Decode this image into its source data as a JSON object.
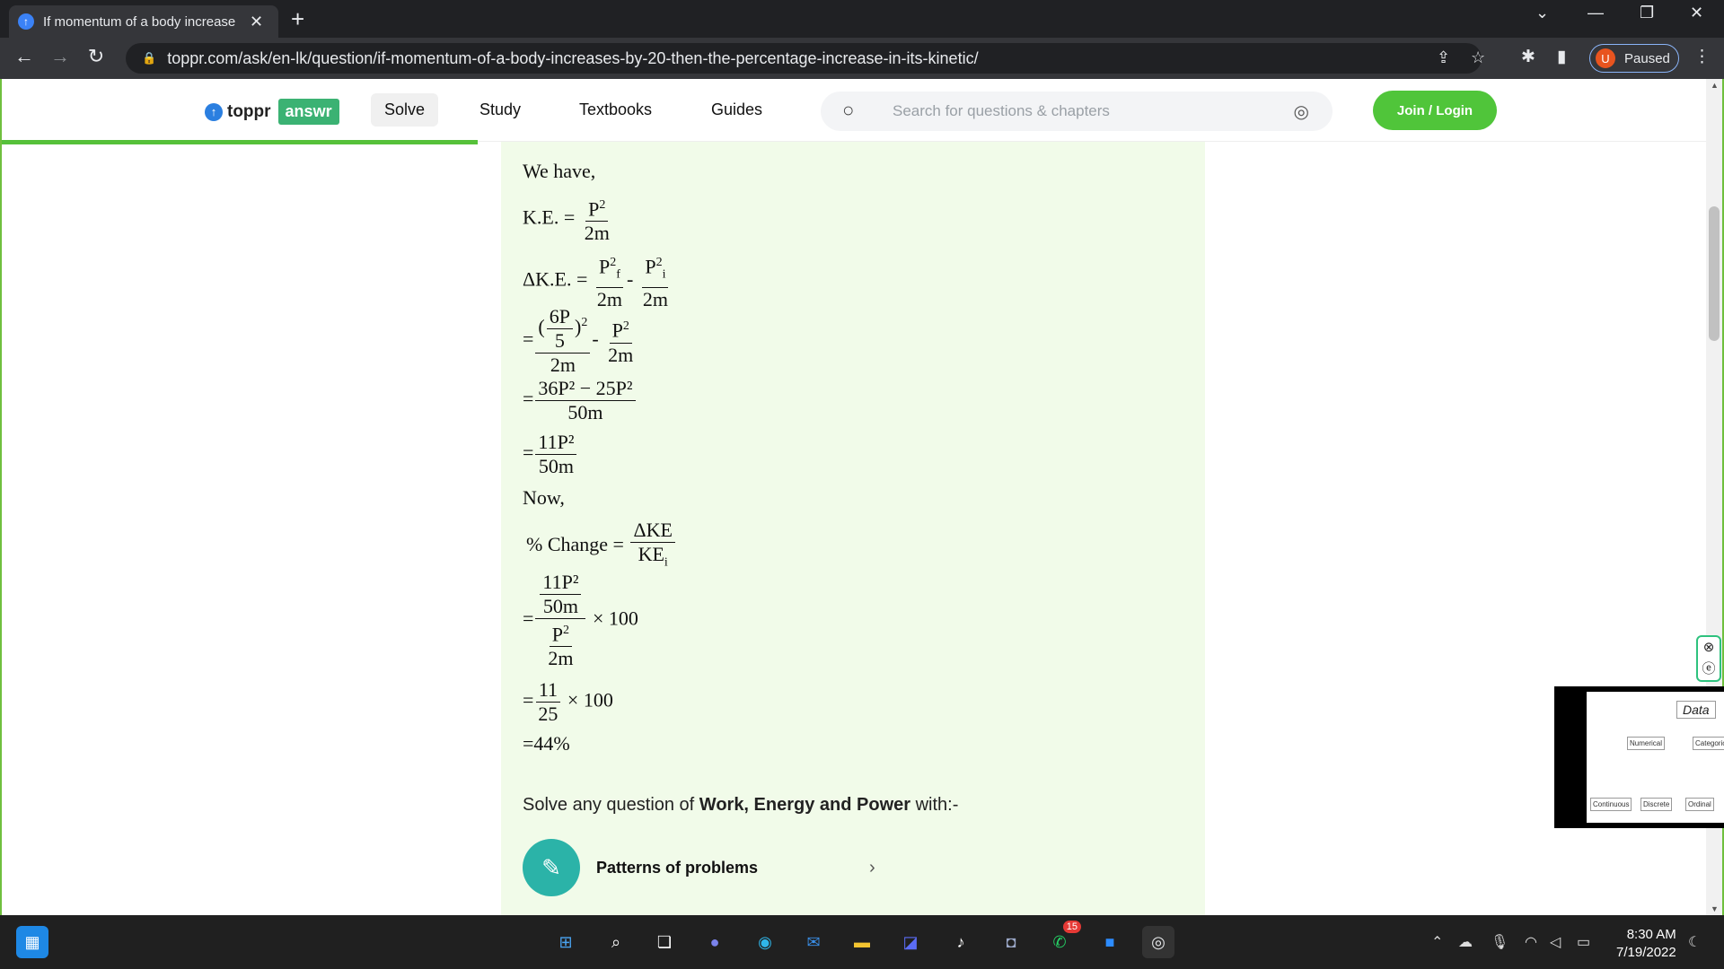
{
  "browser": {
    "tab_title": "If momentum of a body increase",
    "tab_close": "✕",
    "new_tab": "+",
    "url": "toppr.com/ask/en-lk/question/if-momentum-of-a-body-increases-by-20-then-the-percentage-increase-in-its-kinetic/",
    "profile_initial": "U",
    "profile_status": "Paused"
  },
  "site": {
    "logo_text": "toppr",
    "logo_badge": "answr",
    "nav": [
      "Solve",
      "Study",
      "Textbooks",
      "Guides"
    ],
    "search_placeholder": "Search for questions & chapters",
    "join_label": "Join / Login"
  },
  "solution": {
    "we_have": "We have,",
    "ke_lhs": "K.E. =",
    "p2": "P",
    "two_m": "2m",
    "dke_lhs": "ΔK.E. =",
    "pf": "P",
    "pi": "P",
    "six_p": "6P",
    "five": "5",
    "step3_num": "36P² − 25P²",
    "fifty_m": "50m",
    "eleven_p2": "11P²",
    "now": "Now,",
    "pct_change": "% Change =",
    "dke": "ΔKE",
    "kei": "KE",
    "times_100": "× 100",
    "eleven": "11",
    "twenty_five": "25",
    "result": "=44%"
  },
  "footer_section": {
    "solve_prefix": "Solve any question of ",
    "topic": "Work, Energy and Power",
    "solve_suffix": " with:-",
    "pattern_label": "Patterns of problems"
  },
  "thumbnail": {
    "title": "Data",
    "numerical": "Numerical",
    "categorical": "Categorical",
    "continuous": "Continuous",
    "discrete": "Discrete",
    "ordinal": "Ordinal"
  },
  "taskbar": {
    "whatsapp_badge": "15",
    "time": "8:30 AM",
    "date": "7/19/2022"
  },
  "colors": {
    "brand_green": "#50c53a",
    "content_bg": "#f1fbe9",
    "browser_dark": "#202124"
  }
}
